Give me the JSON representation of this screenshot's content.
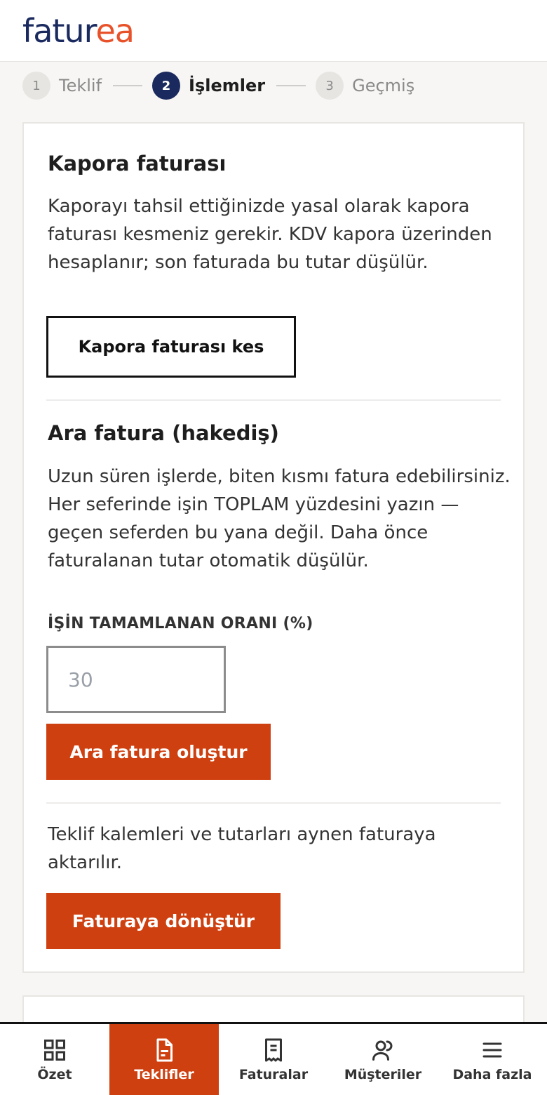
{
  "brand": {
    "logo_part1": "fatur",
    "logo_part2": "ea",
    "color_primary": "#1a2a5e",
    "color_accent": "#e8522a"
  },
  "stepper": [
    {
      "num": "1",
      "label": "Teklif",
      "active": false
    },
    {
      "num": "2",
      "label": "İşlemler",
      "active": true
    },
    {
      "num": "3",
      "label": "Geçmiş",
      "active": false
    }
  ],
  "kapora": {
    "title": "Kapora faturası",
    "description": "Kaporayı tahsil ettiğinizde yasal olarak kapora faturası kesmeniz gerekir. KDV kapora üzerinden hesaplanır; son faturada bu tutar düşülür.",
    "button_label": "Kapora faturası kes"
  },
  "ara_fatura": {
    "title": "Ara fatura (hakediş)",
    "description": "Uzun süren işlerde, biten kısmı fatura edebilirsiniz. Her seferinde işin TOPLAM yüzdesini yazın — geçen seferden bu yana değil. Daha önce faturalanan tutar otomatik düşülür.",
    "field_label": "İŞİN TAMAMLANAN ORANI (%)",
    "field_placeholder": "30",
    "field_value": "",
    "button_label": "Ara fatura oluştur"
  },
  "convert": {
    "description": "Teklif kalemleri ve tutarları aynen faturaya aktarılır.",
    "button_label": "Faturaya dönüştür"
  },
  "bottom_nav": [
    {
      "label": "Özet",
      "icon": "grid-icon",
      "active": false
    },
    {
      "label": "Teklifler",
      "icon": "document-icon",
      "active": true
    },
    {
      "label": "Faturalar",
      "icon": "receipt-icon",
      "active": false
    },
    {
      "label": "Müşteriler",
      "icon": "users-icon",
      "active": false
    },
    {
      "label": "Daha fazla",
      "icon": "menu-icon",
      "active": false
    }
  ],
  "colors": {
    "button": "#cf4010",
    "background": "#f7f6f4"
  }
}
